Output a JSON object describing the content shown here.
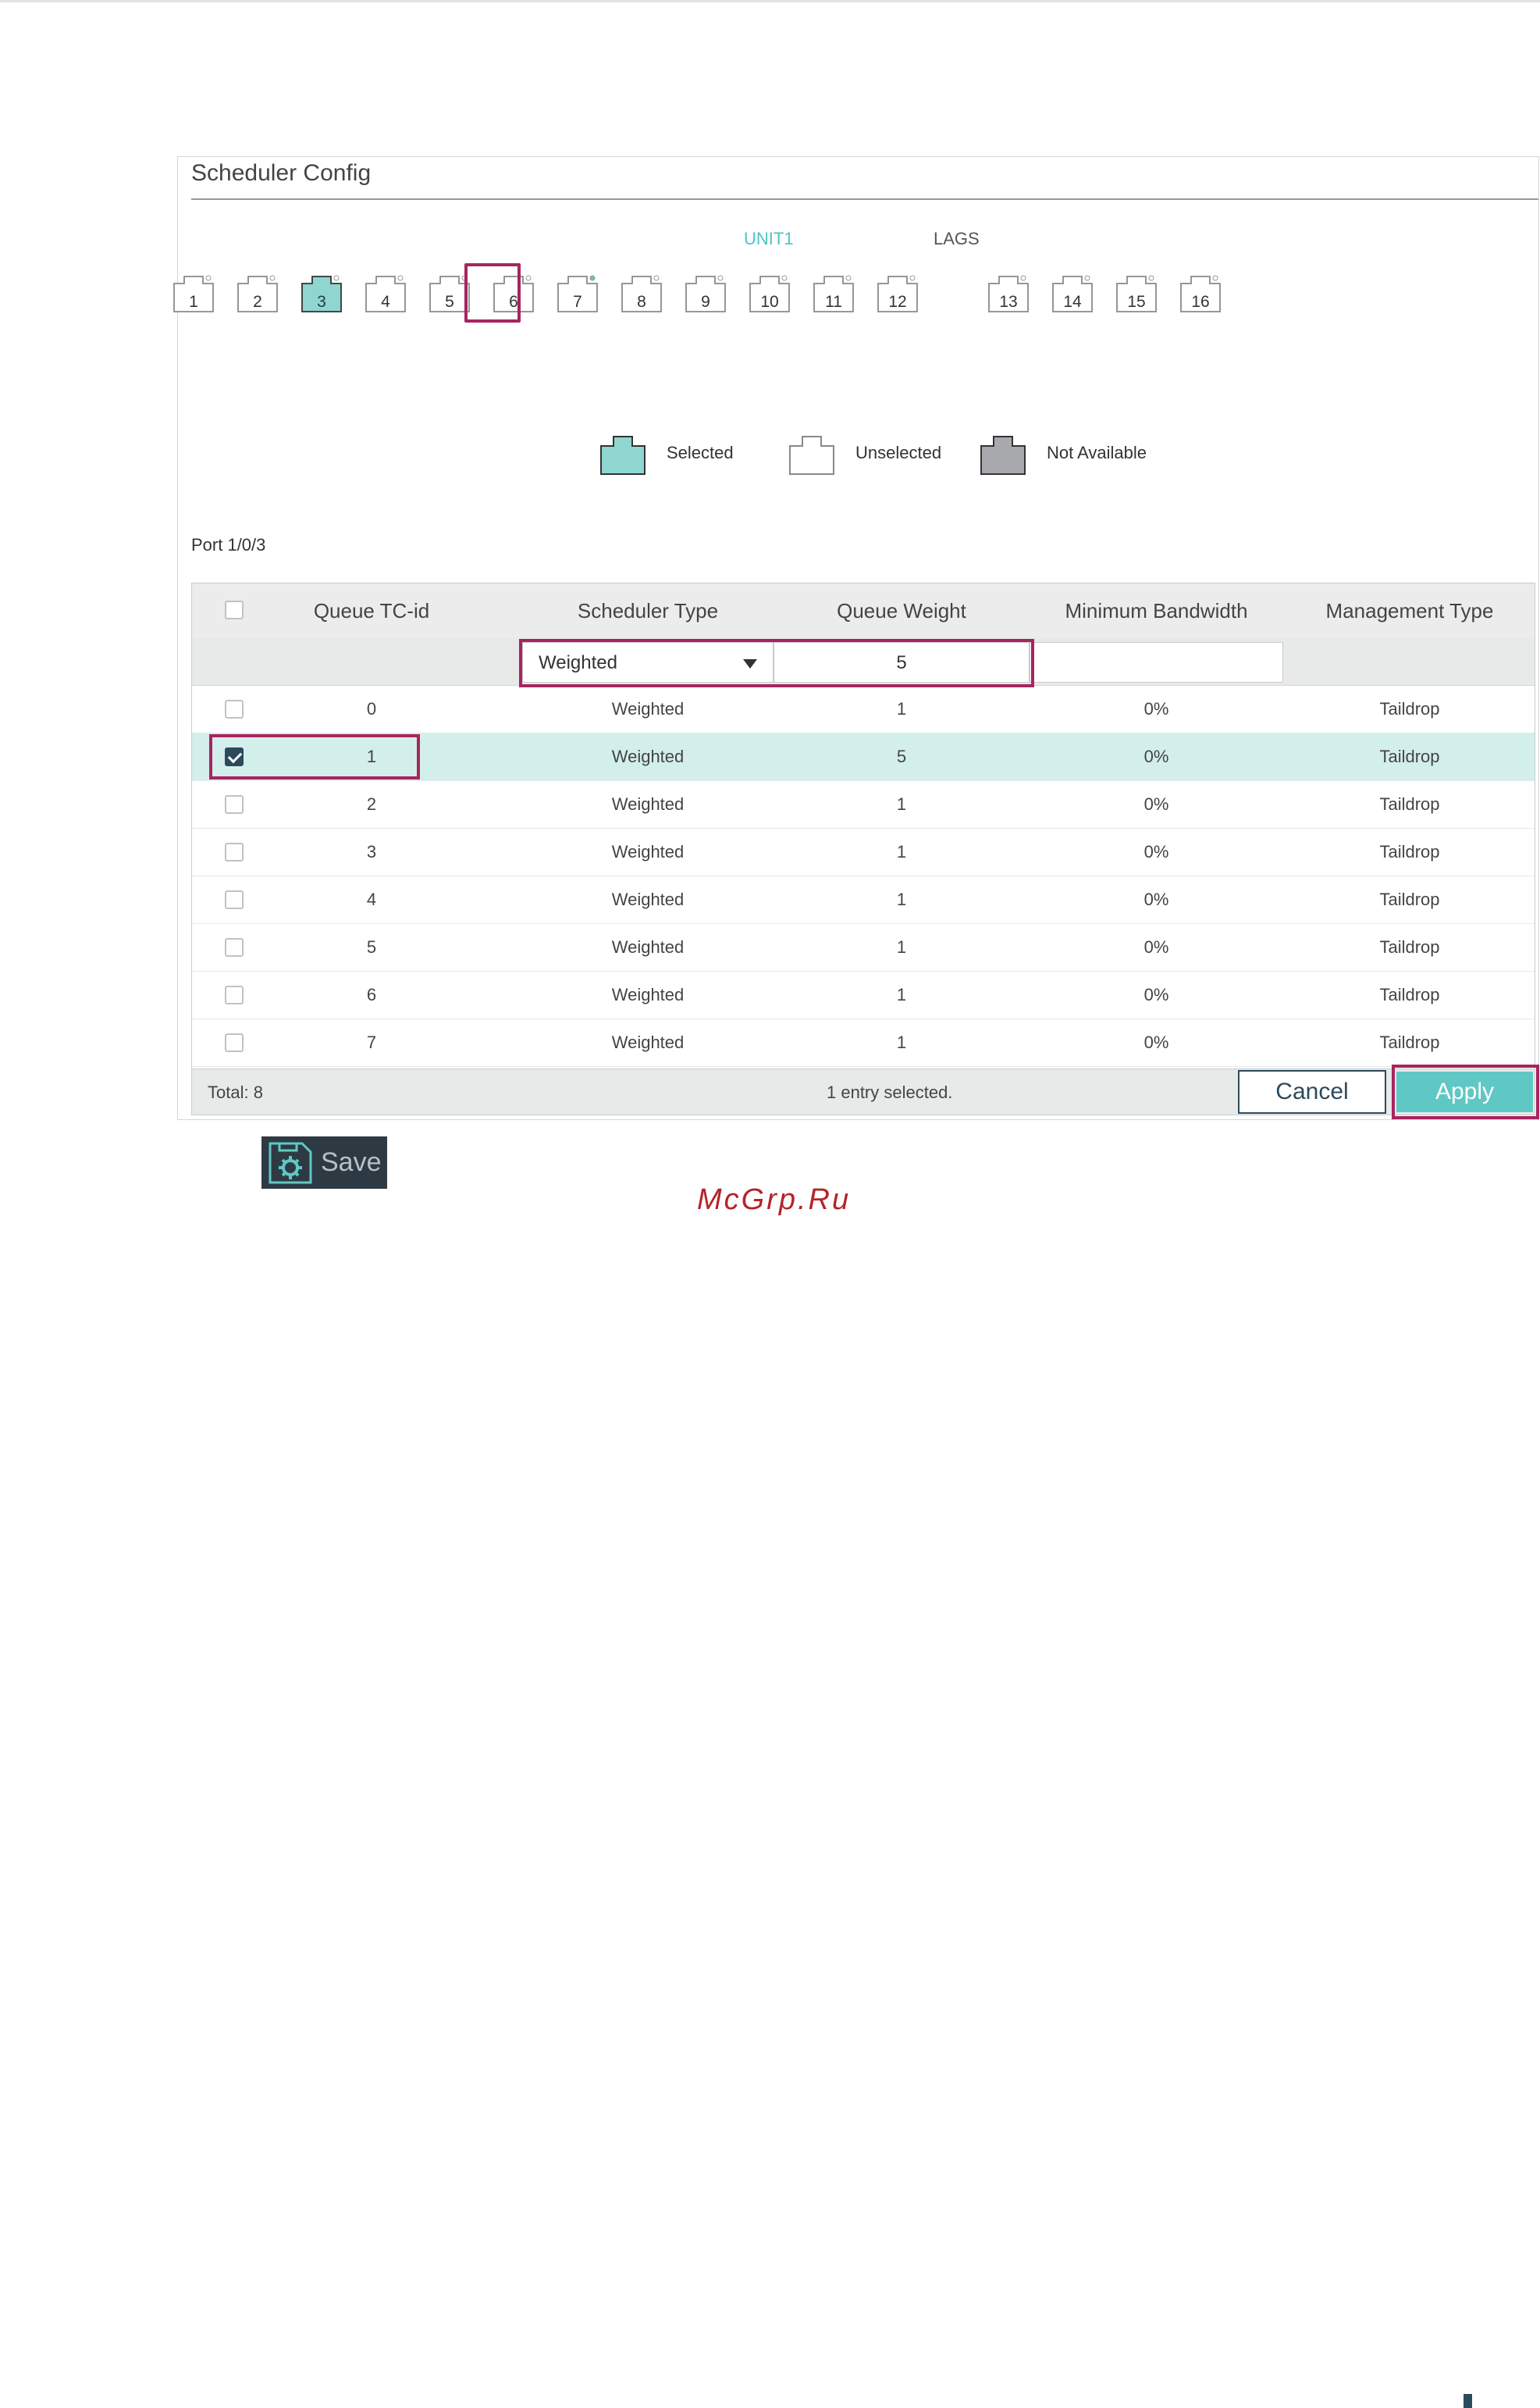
{
  "panel": {
    "title": "Scheduler Config"
  },
  "tabs": {
    "unit": "UNIT1",
    "lags": "LAGS"
  },
  "ports": [
    "1",
    "2",
    "3",
    "4",
    "5",
    "6",
    "7",
    "8",
    "9",
    "10",
    "11",
    "12",
    "13",
    "14",
    "15",
    "16"
  ],
  "selected_port": "3",
  "legend": {
    "selected": "Selected",
    "unselected": "Unselected",
    "not_available": "Not Available"
  },
  "port_label": "Port 1/0/3",
  "table": {
    "headers": [
      "Queue TC-id",
      "Scheduler Type",
      "Queue Weight",
      "Minimum Bandwidth",
      "Management Type"
    ],
    "edit_row": {
      "scheduler_type": "Weighted",
      "queue_weight": "5",
      "minimum_bandwidth": ""
    },
    "rows": [
      {
        "id": "0",
        "type": "Weighted",
        "weight": "1",
        "bw": "0%",
        "mgmt": "Taildrop",
        "checked": false
      },
      {
        "id": "1",
        "type": "Weighted",
        "weight": "5",
        "bw": "0%",
        "mgmt": "Taildrop",
        "checked": true
      },
      {
        "id": "2",
        "type": "Weighted",
        "weight": "1",
        "bw": "0%",
        "mgmt": "Taildrop",
        "checked": false
      },
      {
        "id": "3",
        "type": "Weighted",
        "weight": "1",
        "bw": "0%",
        "mgmt": "Taildrop",
        "checked": false
      },
      {
        "id": "4",
        "type": "Weighted",
        "weight": "1",
        "bw": "0%",
        "mgmt": "Taildrop",
        "checked": false
      },
      {
        "id": "5",
        "type": "Weighted",
        "weight": "1",
        "bw": "0%",
        "mgmt": "Taildrop",
        "checked": false
      },
      {
        "id": "6",
        "type": "Weighted",
        "weight": "1",
        "bw": "0%",
        "mgmt": "Taildrop",
        "checked": false
      },
      {
        "id": "7",
        "type": "Weighted",
        "weight": "1",
        "bw": "0%",
        "mgmt": "Taildrop",
        "checked": false
      }
    ],
    "footer": {
      "total": "Total: 8",
      "selection": "1 entry selected."
    }
  },
  "buttons": {
    "cancel": "Cancel",
    "apply": "Apply",
    "save": "Save"
  },
  "watermark": "McGrp.Ru",
  "colors": {
    "accent": "#5fc8c4",
    "highlight": "#a8245f",
    "selected_row": "#d3efeb",
    "dark": "#2c4a5c"
  },
  "icons": {
    "port": "ethernet-port-icon",
    "save": "save-gear-icon",
    "dropdown": "caret-down-icon"
  }
}
